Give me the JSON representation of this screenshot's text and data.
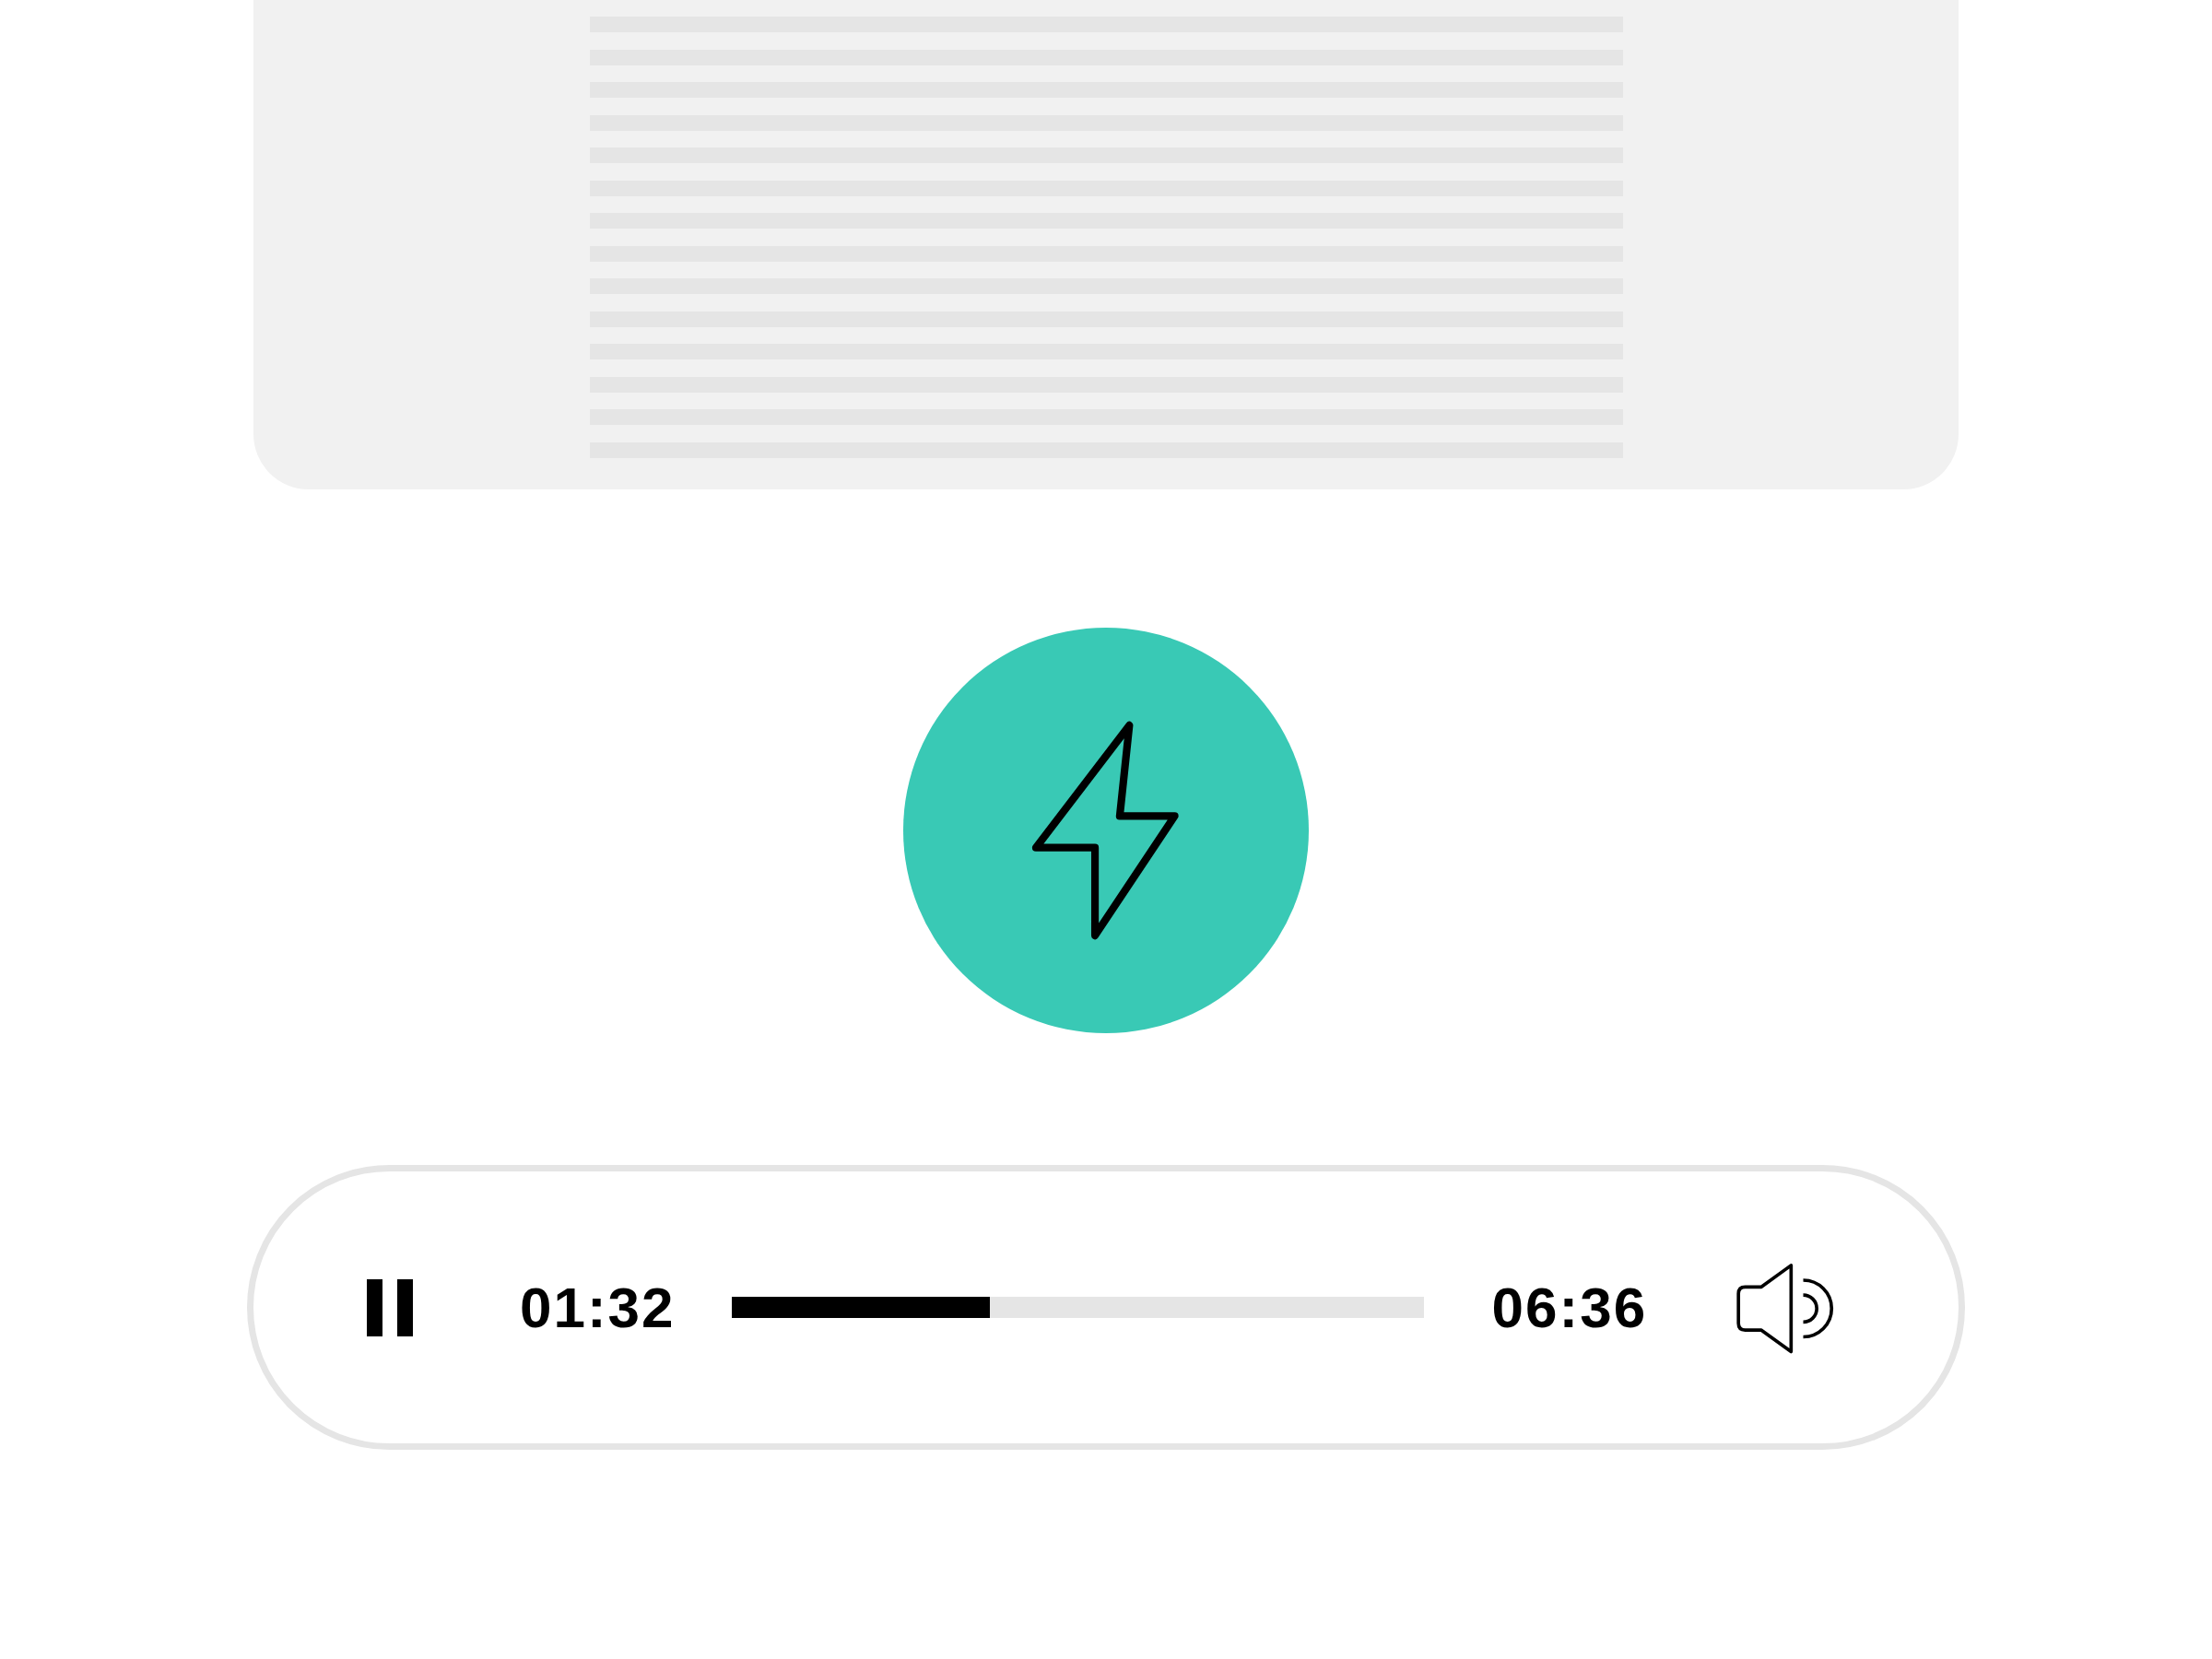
{
  "player": {
    "playing": true,
    "elapsed": "01:32",
    "duration": "06:36",
    "level": 0.373
  }
}
